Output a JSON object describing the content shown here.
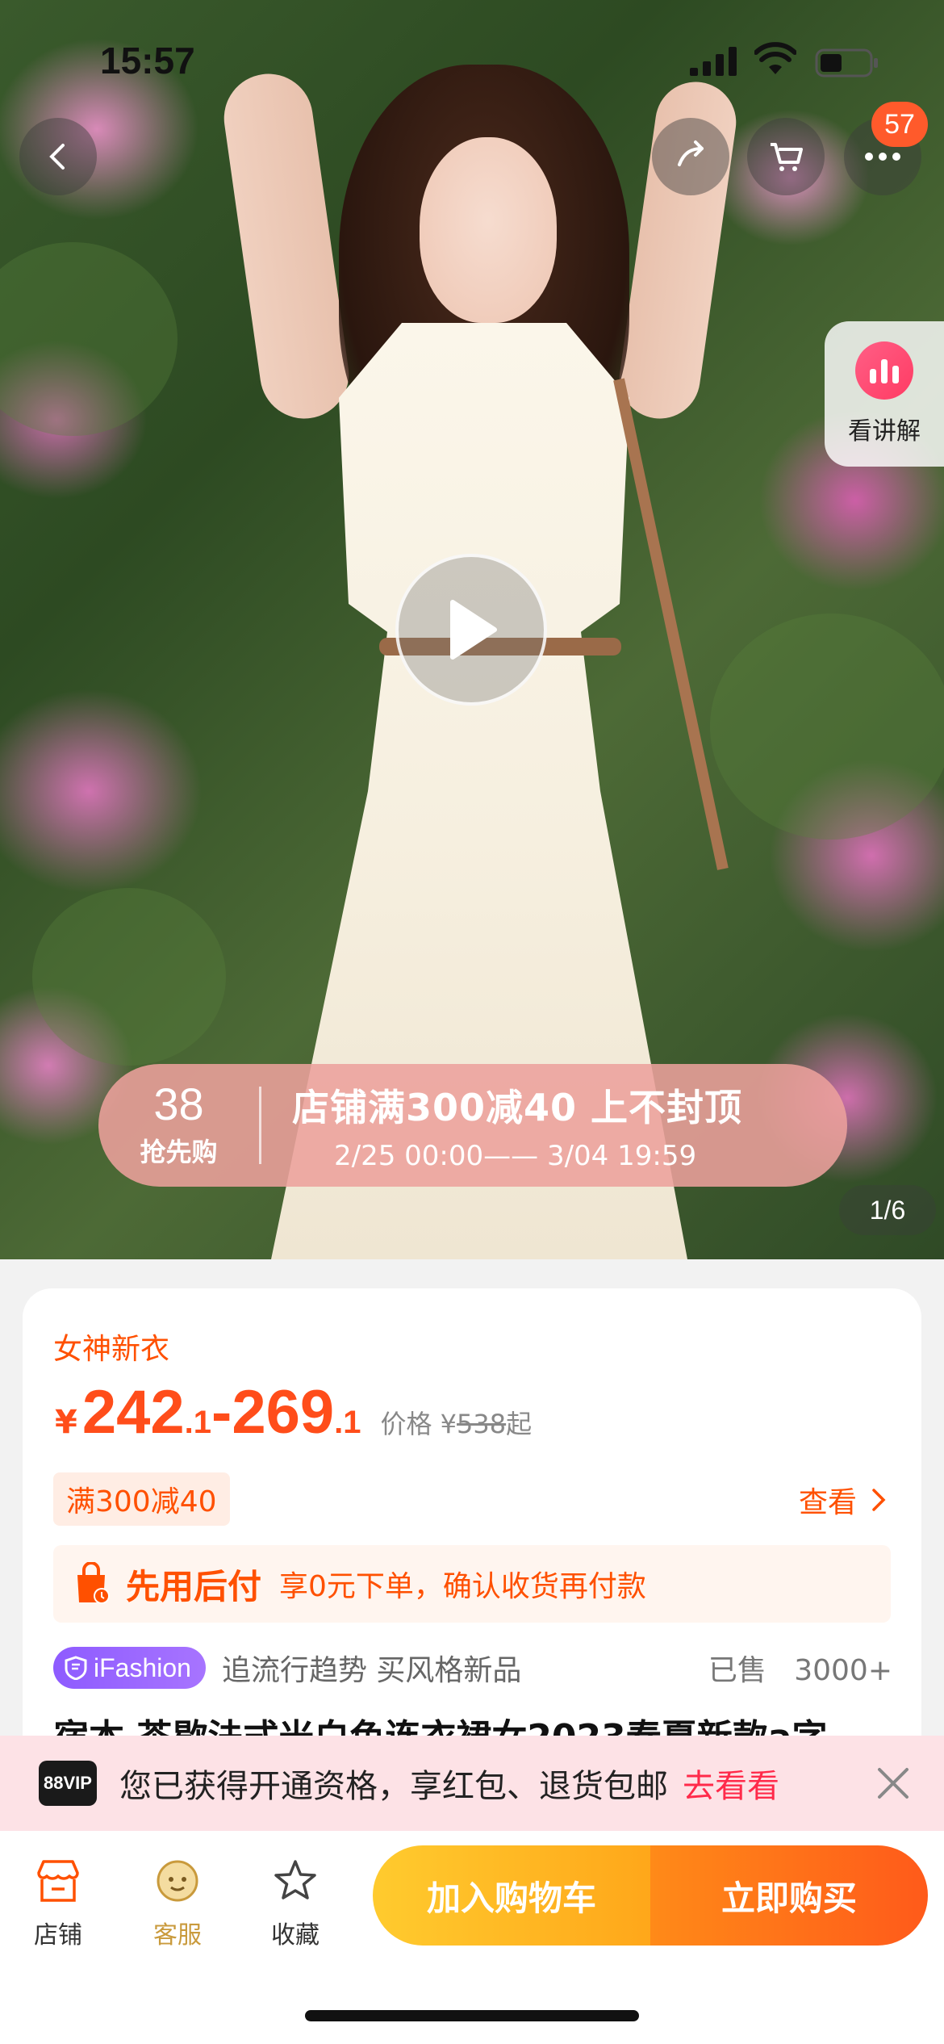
{
  "status_bar": {
    "time": "15:57"
  },
  "header": {
    "message_badge": "57"
  },
  "media": {
    "explain_label": "看讲解",
    "page_indicator": "1/6",
    "promo": {
      "badge_num": "38",
      "badge_text": "抢先购",
      "title": "店铺满300减40 上不封顶",
      "time": "2/25 00:00—— 3/04 19:59"
    }
  },
  "product": {
    "tagline": "女神新衣",
    "price_symbol": "¥",
    "price_low_int": "242",
    "price_low_dec": ".1",
    "price_sep": "-",
    "price_high_int": "269",
    "price_high_dec": ".1",
    "orig_label": "价格 ¥",
    "orig_price": "538",
    "orig_suffix": "起",
    "coupon": "满300减40",
    "view_label": "查看",
    "paylater_title": "先用后付",
    "paylater_desc": "享0元下单，确认收货再付款",
    "ifashion_label": "iFashion",
    "ifashion_slogan": "追流行趋势 买风格新品",
    "sold_label": "已售",
    "sold_count": "3000+",
    "title": "宿本 茶歇法式米白色连衣裙女2023春夏新款a字"
  },
  "vip_bar": {
    "logo": "88VIP",
    "text": "您已获得开通资格，享红包、退货包邮",
    "link": "去看看"
  },
  "bottom_bar": {
    "shop_label": "店铺",
    "service_label": "客服",
    "favorite_label": "收藏",
    "cart_label": "加入购物车",
    "buy_label": "立即购买"
  }
}
